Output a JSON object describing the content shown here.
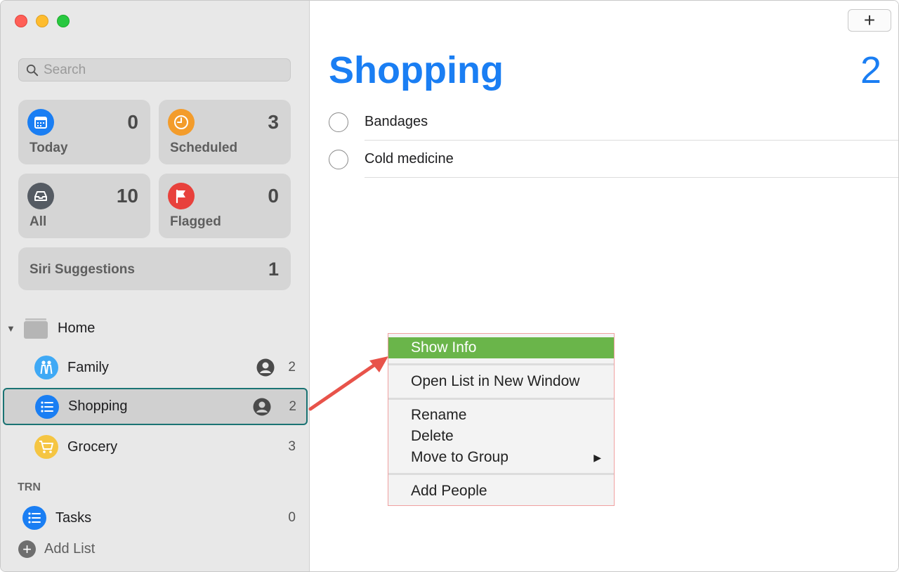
{
  "sidebar": {
    "search": {
      "placeholder": "Search"
    },
    "smart_lists": [
      {
        "label": "Today",
        "count": "0",
        "icon": "calendar-icon",
        "color": "#1a7ef3"
      },
      {
        "label": "Scheduled",
        "count": "3",
        "icon": "clock-icon",
        "color": "#f39c2b"
      },
      {
        "label": "All",
        "count": "10",
        "icon": "tray-icon",
        "color": "#555b63"
      },
      {
        "label": "Flagged",
        "count": "0",
        "icon": "flag-icon",
        "color": "#e8413c"
      }
    ],
    "siri": {
      "label": "Siri Suggestions",
      "count": "1"
    },
    "groups": [
      {
        "label": "Home",
        "lists": [
          {
            "name": "Family",
            "count": "2",
            "icon": "people-icon",
            "color": "#3fa9f5"
          },
          {
            "name": "Shopping",
            "count": "2",
            "icon": "list-icon",
            "color": "#1a7ef3"
          },
          {
            "name": "Grocery",
            "count": "3",
            "icon": "cart-icon",
            "color": "#f5c542"
          }
        ]
      }
    ],
    "section": {
      "label": "TRN",
      "lists": [
        {
          "name": "Tasks",
          "count": "0",
          "icon": "list-icon",
          "color": "#1a7ef3"
        }
      ]
    },
    "add_list_label": "Add List"
  },
  "main": {
    "title": "Shopping",
    "count": "2",
    "add_button": "+",
    "items": [
      {
        "title": "Bandages"
      },
      {
        "title": "Cold medicine"
      }
    ]
  },
  "context_menu": {
    "items": [
      "Show Info",
      "Open List in New Window",
      "Rename",
      "Delete",
      "Move to Group",
      "Add People"
    ],
    "highlight_color": "#6ab54a"
  },
  "colors": {
    "accent": "#1a7ef3",
    "selection_border": "#1a7373",
    "annotation_arrow": "#e8534a"
  }
}
